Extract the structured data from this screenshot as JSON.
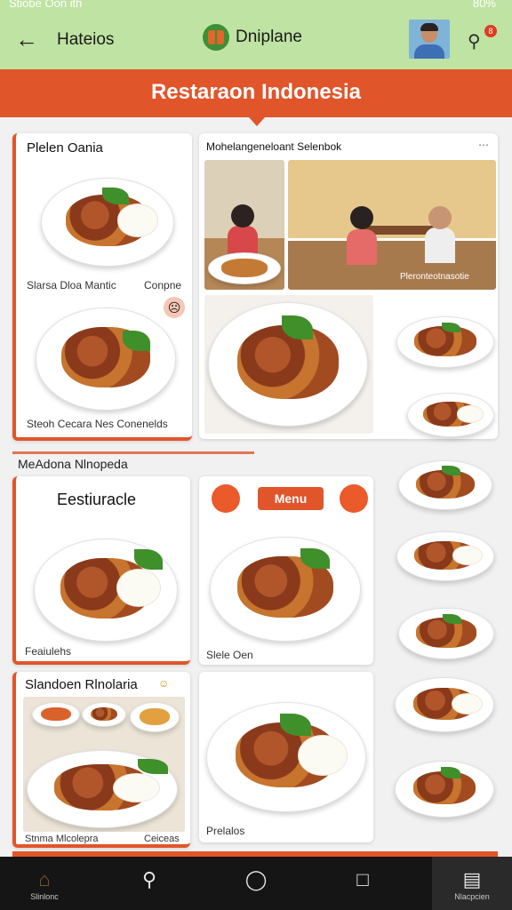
{
  "status_bar": {
    "left_text": "Stiobe Oon ith",
    "right_text": "80%"
  },
  "app_bar": {
    "title": "Hateios",
    "brand_name": "Dniplane",
    "cart_badge": "8",
    "colors": {
      "background": "#bfe3a2"
    }
  },
  "banner": {
    "title": "Restaraon Indonesia",
    "colors": {
      "background": "#e1552b"
    }
  },
  "featured": {
    "card1": {
      "title": "Plelen Oania",
      "caption_top": "Slarsa Dloa Mantic",
      "caption_top_right": "Conpne",
      "caption_bottom": "Steoh Cecara Nes Conenelds"
    },
    "card2": {
      "title": "Mohelangeneloant Selenbok",
      "photo_caption": "Pleronteotnasotie"
    }
  },
  "section": {
    "title": "MeAdona Nlnopeda"
  },
  "grid": {
    "card3": {
      "title": "Eestiuracle",
      "caption": "Feaiulehs"
    },
    "menu_card": {
      "button_label": "Menu",
      "caption": "Slele Oen"
    },
    "card5": {
      "title": "Slandoen Rlnolaria",
      "caption_left": "Stnma Mlcolepra",
      "caption_right": "Ceiceas"
    },
    "card6": {
      "caption": "Prelalos"
    }
  },
  "bottom_nav": {
    "items": [
      {
        "icon": "home-icon",
        "label": "Slinlonc"
      },
      {
        "icon": "search-icon",
        "label": ""
      },
      {
        "icon": "circle-home-icon",
        "label": ""
      },
      {
        "icon": "square-recents-icon",
        "label": ""
      },
      {
        "icon": "chat-icon",
        "label": "Nlacpcien"
      }
    ]
  }
}
